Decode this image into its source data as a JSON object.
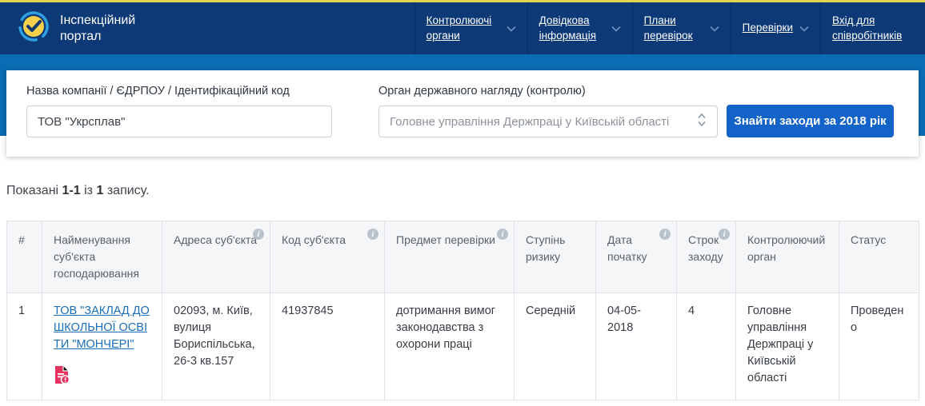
{
  "brand": {
    "title_line1": "Інспекційний",
    "title_line2": "портал"
  },
  "nav": {
    "items": [
      {
        "label": "Контролюючі органи"
      },
      {
        "label": "Довідкова інформація"
      },
      {
        "label": "Плани перевірок"
      },
      {
        "label": "Перевірки"
      },
      {
        "label": "Вхід для співробітників"
      }
    ]
  },
  "search": {
    "company_label": "Назва компанії / ЄДРПОУ / Ідентифікаційний код",
    "company_value": "ТОВ \"Укрсплав\"",
    "authority_label": "Орган державного нагляду (контролю)",
    "authority_value": "Головне управління Держпраці у Київській області",
    "submit_label": "Знайти заходи за 2018 рік"
  },
  "results_summary": {
    "prefix": "Показані",
    "range": "1-1",
    "middle": "із",
    "count": "1",
    "suffix": "запису."
  },
  "table": {
    "columns": [
      {
        "label": "#"
      },
      {
        "label": "Найменування суб'єкта господарювання"
      },
      {
        "label": "Адреса суб'єкта"
      },
      {
        "label": "Код суб'єкта"
      },
      {
        "label": "Предмет перевірки"
      },
      {
        "label": "Ступінь ризику"
      },
      {
        "label": "Дата початку"
      },
      {
        "label": "Строк заходу"
      },
      {
        "label": "Контролюючий орган"
      },
      {
        "label": "Статус"
      }
    ],
    "info_icon_glyph": "i",
    "rows": [
      {
        "index": "1",
        "name": "ТОВ \"ЗАКЛАД ДОШКОЛЬНОЇ ОСВІТИ \"МОНЧЕРІ\"",
        "address": "02093, м. Київ, вулиця Бориспільська, 26-3 кв.157",
        "code": "41937845",
        "subject": "дотримання вимог законодавства з охорони праці",
        "risk": "Середній",
        "start_date": "04-05-2018",
        "duration": "4",
        "authority": "Головне управління Держпраці у Київській області",
        "status": "Проведено"
      }
    ]
  },
  "colors": {
    "header_navy": "#0d3a76",
    "band_blue": "#0a6cb3",
    "accent_yellow": "#e3d24d",
    "button_blue": "#1463c8",
    "link_blue": "#1a6db9",
    "alert_red": "#e5335f"
  }
}
